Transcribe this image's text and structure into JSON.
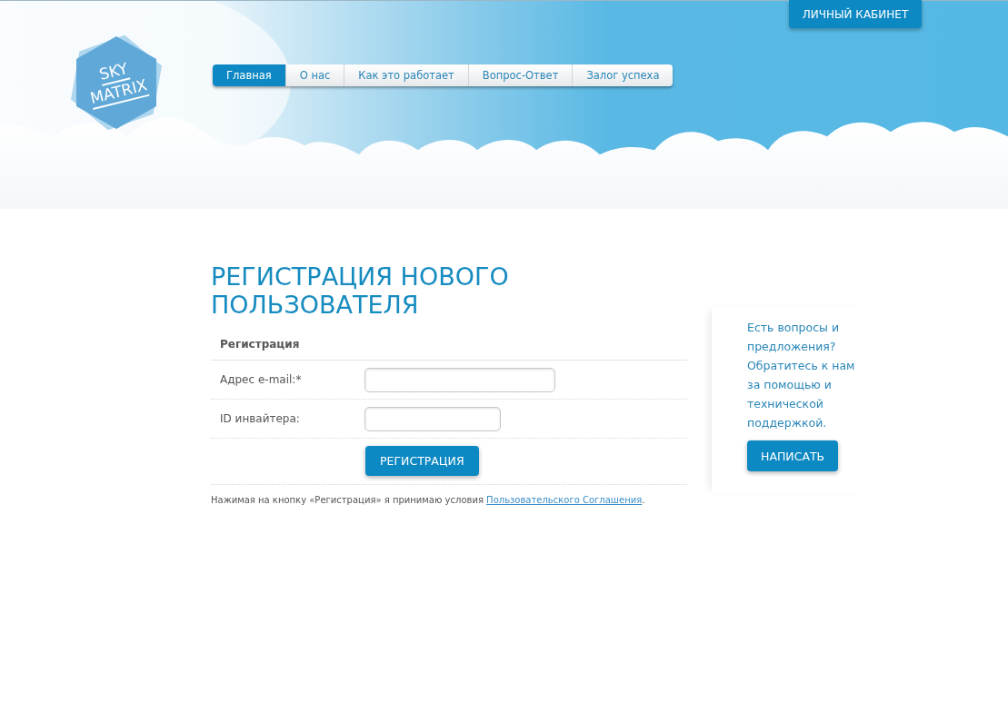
{
  "header": {
    "logo": {
      "line_1": "SKY",
      "line_2": "MATRIX"
    },
    "nav": [
      {
        "label": "Главная",
        "selected": true
      },
      {
        "label": "О нас",
        "selected": false
      },
      {
        "label": "Как это работает",
        "selected": false
      },
      {
        "label": "Вопрос-Ответ",
        "selected": false
      },
      {
        "label": "Залог успеха",
        "selected": false
      }
    ],
    "account_button": "ЛИЧНЫЙ КАБИНЕТ"
  },
  "page_title": "РЕГИСТРАЦИЯ НОВОГО ПОЛЬЗОВАТЕЛЯ",
  "form": {
    "heading": "Регистрация",
    "fields": [
      {
        "label": "Адрес e-mail:*",
        "kind": "wide"
      },
      {
        "label": "ID инвайтера:",
        "kind": "narrow"
      }
    ],
    "submit": "РЕГИСТРАЦИЯ",
    "agreement": {
      "text": "Нажимая на кнопку «Регистрация» я принимаю условия",
      "link": "Пользовательского Соглашения",
      "end": "."
    }
  },
  "sidebar": {
    "text": "Есть вопросы и предложения? Обратитесь к нам за помощью и технической поддержкой.",
    "button": "НАПИСАТЬ"
  }
}
